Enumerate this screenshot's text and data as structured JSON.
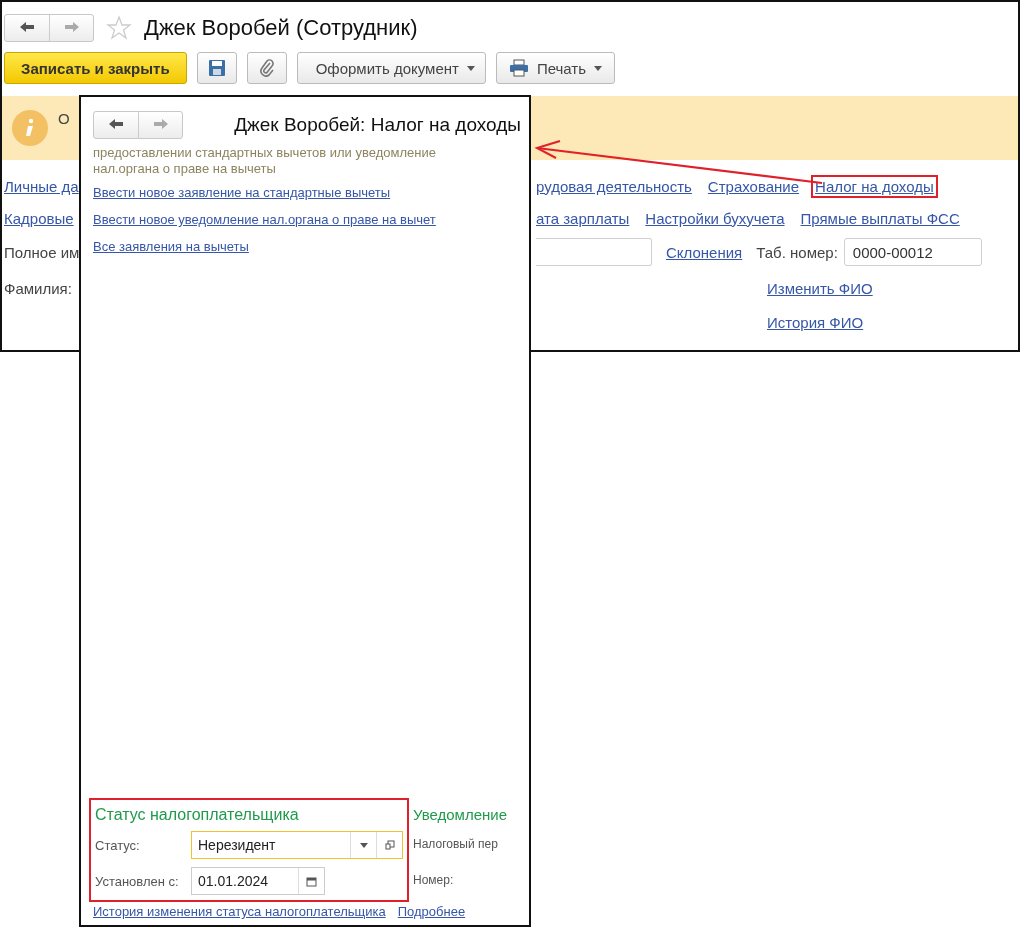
{
  "main_window": {
    "title": "Джек Воробей (Сотрудник)",
    "toolbar": [
      {
        "kind": "primary",
        "label": "Записать и закрыть"
      },
      {
        "kind": "save"
      },
      {
        "kind": "attach"
      },
      {
        "kind": "menu",
        "label": "Оформить документ"
      },
      {
        "kind": "print",
        "label": "Печать"
      }
    ],
    "info_banner": {
      "text": "О"
    },
    "links_left": [
      "Личные да",
      "Кадровые"
    ],
    "links_right": [
      [
        {
          "label": "рудовая деятельность",
          "highlighted": false
        },
        {
          "label": "Страхование",
          "highlighted": false
        },
        {
          "label": "Налог на доходы",
          "highlighted": true
        }
      ],
      [
        {
          "label": "ата зарплаты",
          "highlighted": false
        },
        {
          "label": "Настройки бухучета",
          "highlighted": false
        },
        {
          "label": "Прямые выплаты ФСС",
          "highlighted": false
        }
      ]
    ],
    "full_name_label": "Полное им",
    "declensions_link": "Склонения",
    "tab_number": {
      "label": "Таб. номер:",
      "value": "0000-00012"
    },
    "surname_label": "Фамилия:",
    "change_name_link": "Изменить ФИО",
    "name_history_link": "История ФИО"
  },
  "tax_window": {
    "title": "Джек Воробей: Налог на доходы",
    "note": "предоставлении стандартных вычетов или уведомление нал.органа о праве на вычеты",
    "links": [
      "Ввести новое заявление на стандартные вычеты",
      "Ввести новое уведомление нал.органа о праве на вычет",
      "Все заявления на вычеты"
    ],
    "status_section": {
      "heading": "Статус налогоплательщика",
      "highlighted": true,
      "status": {
        "label": "Статус:",
        "value": "Нерезидент",
        "focused": true
      },
      "since": {
        "label": "Установлен с:",
        "value": "01.01.2024"
      },
      "history_link": "История изменения статуса налогоплательщика"
    },
    "notice_section": {
      "heading": "Уведомление",
      "period_label": "Налоговый пер",
      "number_label": "Номер:",
      "more_link": "Подробнее"
    }
  }
}
